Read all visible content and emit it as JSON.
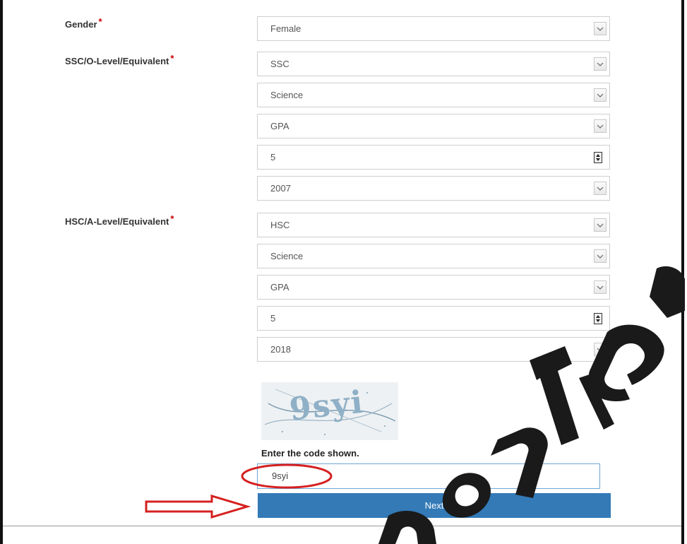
{
  "gender": {
    "label": "Gender",
    "required": "*",
    "value": "Female"
  },
  "ssc": {
    "label": "SSC/O-Level/Equivalent",
    "required": "*",
    "exam": "SSC",
    "group": "Science",
    "result_type": "GPA",
    "result": "5",
    "year": "2007"
  },
  "hsc": {
    "label": "HSC/A-Level/Equivalent",
    "required": "*",
    "exam": "HSC",
    "group": "Science",
    "result_type": "GPA",
    "result": "5",
    "year": "2018"
  },
  "captcha": {
    "image_text": "9syi",
    "prompt": "Enter the code shown.",
    "input_value": "9syi"
  },
  "submit": {
    "label": "Next"
  },
  "colors": {
    "accent": "#337ab7",
    "annotation": "#d62020",
    "required": "#cc0000"
  },
  "icons": {
    "select": "chevron-down-icon",
    "number": "spinner-icon",
    "arrow": "right-arrow-annotation-icon"
  }
}
